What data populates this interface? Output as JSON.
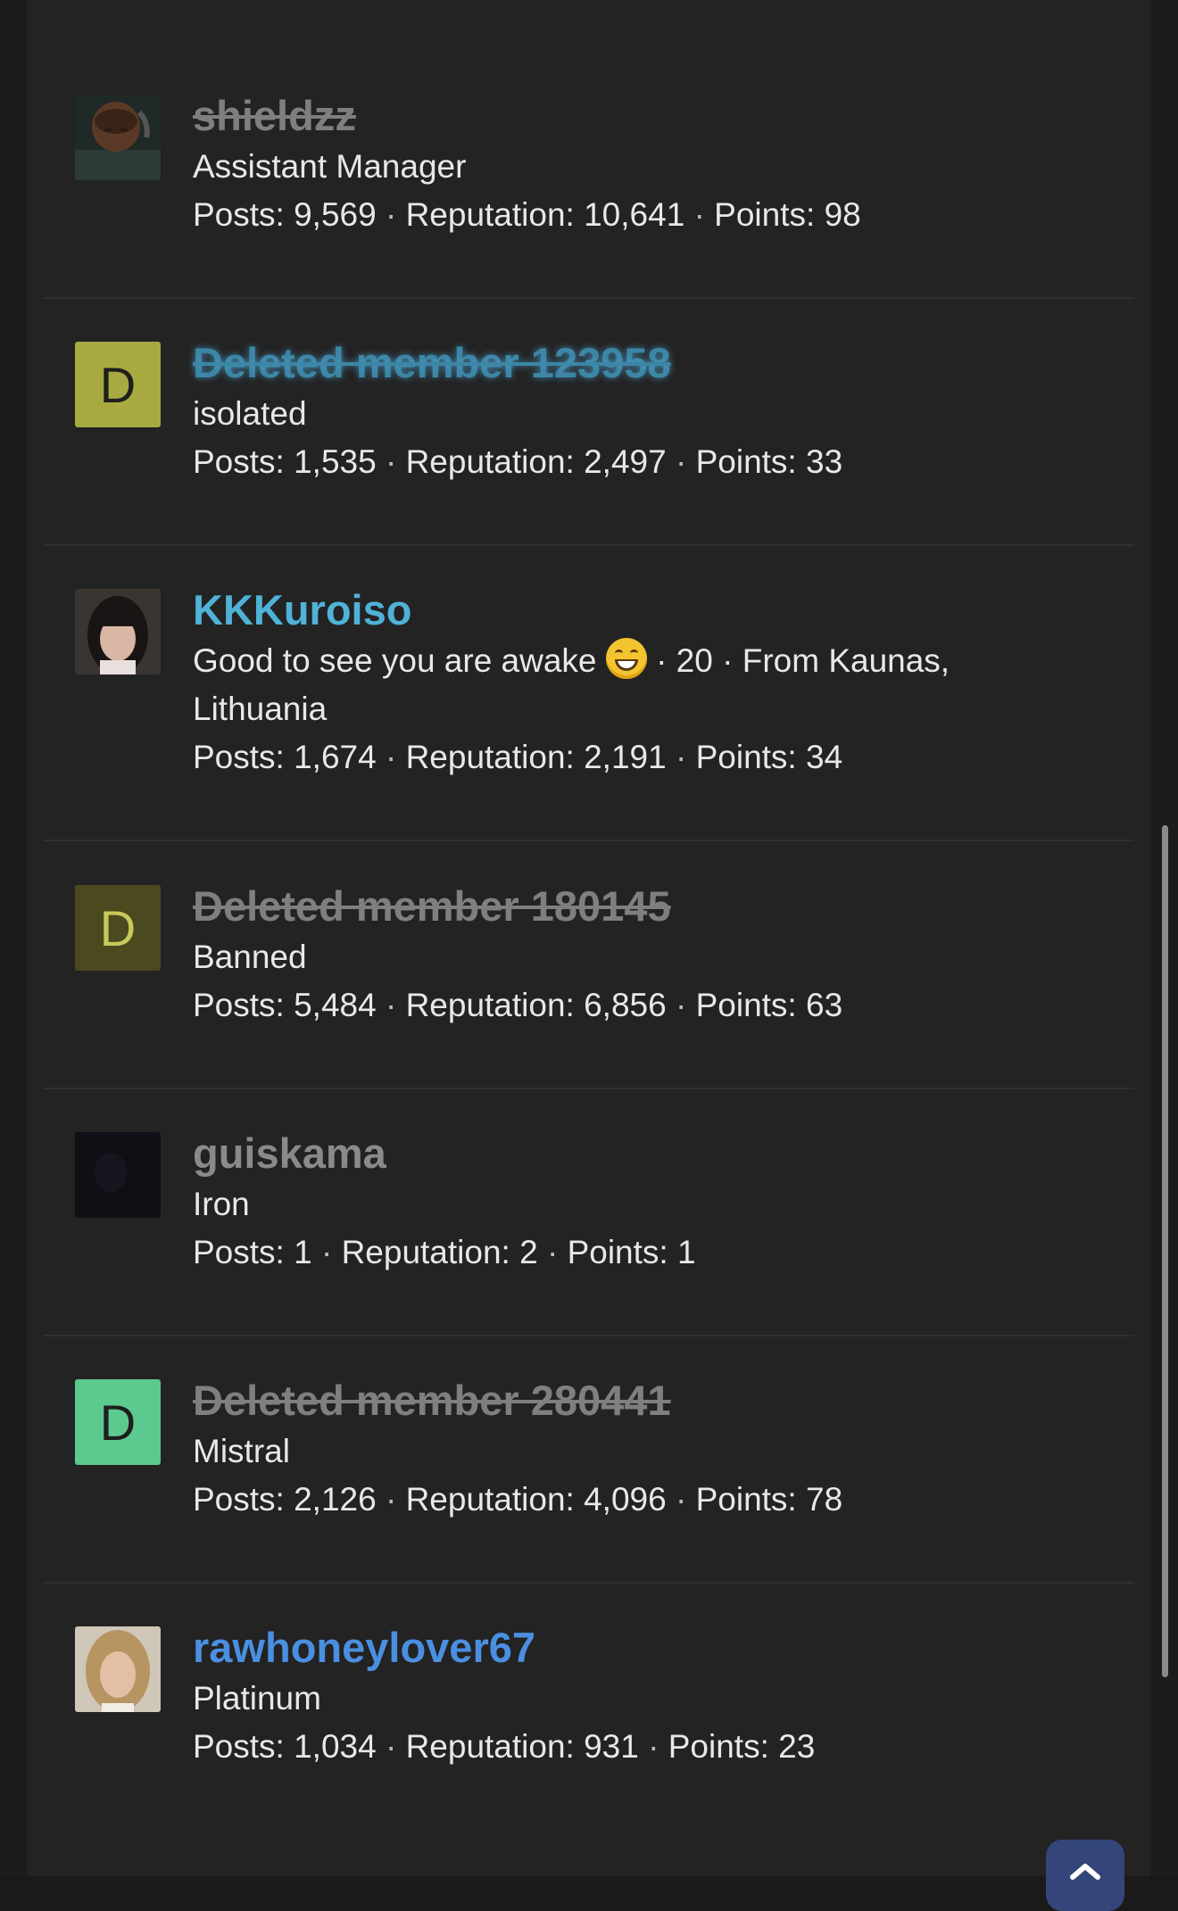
{
  "members": [
    {
      "name": "shieldzz",
      "name_style": "deleted",
      "avatar": {
        "type": "photo",
        "desc": "avatar-photo-dark-headphones"
      },
      "title": "Assistant Manager",
      "stats": {
        "posts": "Posts: 9,569",
        "reputation": "Reputation: 10,641",
        "points": "Points: 98"
      }
    },
    {
      "name": "Deleted member 123958",
      "name_style": "deleted-blue",
      "avatar": {
        "type": "letter",
        "letter": "D",
        "color": "#a9a942",
        "text_color": "#1e1e1e"
      },
      "title": "isolated",
      "stats": {
        "posts": "Posts: 1,535",
        "reputation": "Reputation: 2,497",
        "points": "Points: 33"
      }
    },
    {
      "name": "KKKuroiso",
      "name_style": "active",
      "name_color": "#4fb2d6",
      "avatar": {
        "type": "photo",
        "desc": "avatar-photo-woman-bangs"
      },
      "title_parts": [
        "Good to see you are awake",
        "· 20 · From Kaunas,",
        "Lithuania"
      ],
      "stats": {
        "posts": "Posts: 1,674",
        "reputation": "Reputation: 2,191",
        "points": "Points: 34"
      }
    },
    {
      "name": "Deleted member 180145",
      "name_style": "deleted",
      "avatar": {
        "type": "letter",
        "letter": "D",
        "color": "#4a4a1e",
        "text_color": "#c9c95a"
      },
      "title": "Banned",
      "stats": {
        "posts": "Posts: 5,484",
        "reputation": "Reputation: 6,856",
        "points": "Points: 63"
      }
    },
    {
      "name": "guiskama",
      "name_style": "muted",
      "name_color": "#8a8a8a",
      "avatar": {
        "type": "photo",
        "desc": "avatar-photo-dark"
      },
      "title": "Iron",
      "stats": {
        "posts": "Posts: 1",
        "reputation": "Reputation: 2",
        "points": "Points: 1"
      }
    },
    {
      "name": "Deleted member 280441",
      "name_style": "deleted",
      "avatar": {
        "type": "letter",
        "letter": "D",
        "color": "#5cc98e",
        "text_color": "#1e1e1e"
      },
      "title": "Mistral",
      "stats": {
        "posts": "Posts: 2,126",
        "reputation": "Reputation: 4,096",
        "points": "Points: 78"
      }
    },
    {
      "name": "rawhoneylover67",
      "name_style": "active",
      "name_color": "#4a8fe0",
      "avatar": {
        "type": "photo",
        "desc": "avatar-photo-long-hair"
      },
      "title": "Platinum",
      "stats": {
        "posts": "Posts: 1,034",
        "reputation": "Reputation: 931",
        "points": "Points: 23"
      }
    }
  ],
  "separator": "·",
  "scroll_top_icon": "chevron-up-icon"
}
